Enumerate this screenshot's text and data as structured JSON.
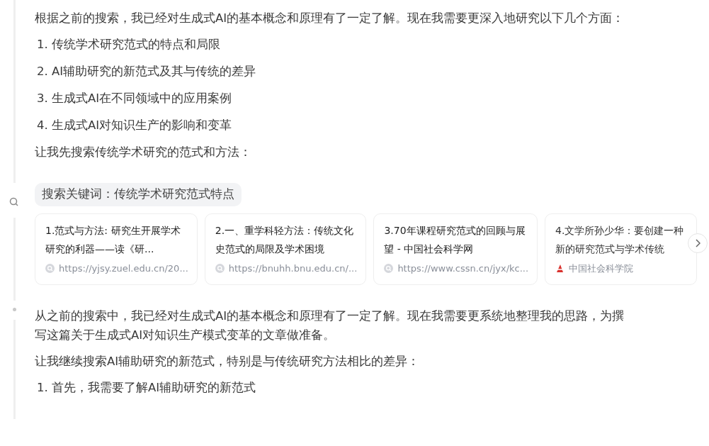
{
  "steps": [
    {
      "kind": "text",
      "blocks": [
        {
          "kind": "paragraph",
          "text": "根据之前的搜索，我已经对生成式AI的基本概念和原理有了一定了解。现在我需要更深入地研究以下几个方面："
        },
        {
          "kind": "list",
          "items": [
            "1. 传统学术研究范式的特点和局限",
            "2. AI辅助研究的新范式及其与传统的差异",
            "3. 生成式AI在不同领域中的应用案例",
            "4. 生成式AI对知识生产的影响和变革"
          ]
        },
        {
          "kind": "paragraph",
          "text": "让我先搜索传统学术研究的范式和方法："
        }
      ]
    },
    {
      "kind": "search",
      "query": "搜索关键词：传统学术研究范式特点",
      "results": [
        {
          "title": "1.范式与方法: 研究生开展学术研究的利器——读《研...",
          "source": "https://yjsy.zuel.edu.cn/20...",
          "kind": "generic"
        },
        {
          "title": "2.一、重学科轻方法：传统文化史范式的局限及学术困境",
          "source": "https://bnuhh.bnu.edu.cn/...",
          "kind": "generic"
        },
        {
          "title": "3.70年课程研究范式的回顾与展望 - 中国社会科学网",
          "source": "https://www.cssn.cn/jyx/kc...",
          "kind": "generic"
        },
        {
          "title": "4.文学所孙少华：要创建一种新的研究范式与学术传统",
          "source": "中国社会科学院",
          "kind": "logo"
        }
      ]
    },
    {
      "kind": "text",
      "blocks": [
        {
          "kind": "paragraph",
          "text": "从之前的搜索中，我已经对生成式AI的基本概念和原理有了一定了解。现在我需要更系统地整理我的思路，为撰写这篇关于生成式AI对知识生产模式变革的文章做准备。"
        },
        {
          "kind": "paragraph",
          "text": "让我继续搜索AI辅助研究的新范式，特别是与传统研究方法相比的差异："
        },
        {
          "kind": "list",
          "items": [
            "1. 首先，我需要了解AI辅助研究的新范式"
          ]
        }
      ]
    }
  ]
}
